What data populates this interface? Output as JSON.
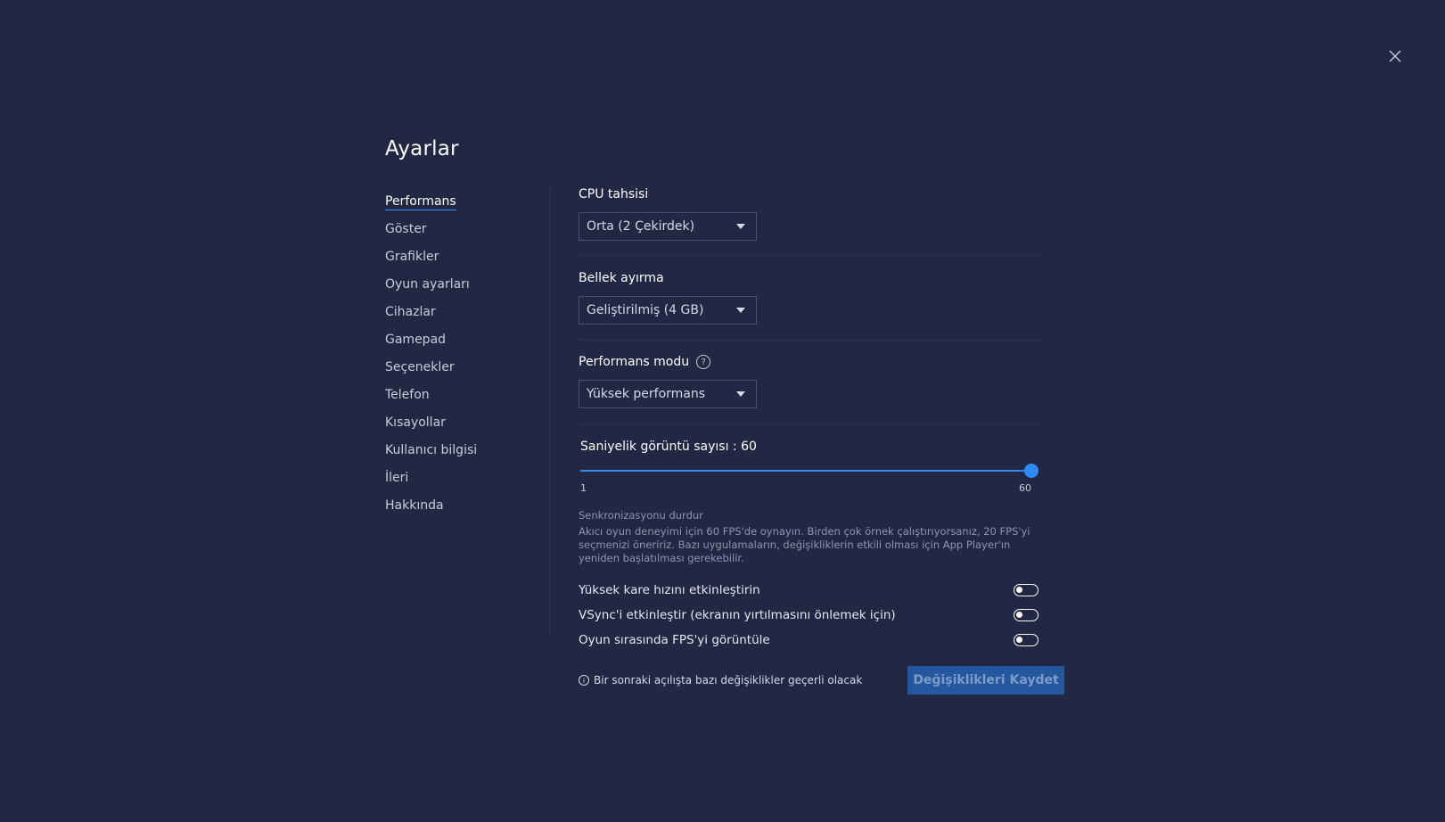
{
  "window": {
    "title": "Ayarlar"
  },
  "sidebar": {
    "items": [
      {
        "label": "Performans",
        "active": true
      },
      {
        "label": "Göster"
      },
      {
        "label": "Grafikler"
      },
      {
        "label": "Oyun ayarları"
      },
      {
        "label": "Cihazlar"
      },
      {
        "label": "Gamepad"
      },
      {
        "label": "Seçenekler"
      },
      {
        "label": "Telefon"
      },
      {
        "label": "Kısayollar"
      },
      {
        "label": "Kullanıcı bilgisi"
      },
      {
        "label": "İleri"
      },
      {
        "label": "Hakkında"
      }
    ]
  },
  "performance": {
    "cpu": {
      "label": "CPU tahsisi",
      "value": "Orta (2 Çekirdek)"
    },
    "memory": {
      "label": "Bellek ayırma",
      "value": "Geliştirilmiş (4 GB)"
    },
    "mode": {
      "label": "Performans modu",
      "help_icon": "?",
      "value": "Yüksek performans"
    },
    "fps": {
      "label": "Saniyelik görüntü sayısı : 60",
      "value": 60,
      "min": 1,
      "max": 60,
      "min_label": "1",
      "max_label": "60",
      "sync_label": "Senkronizasyonu durdur",
      "description": "Akıcı oyun deneyimi için 60 FPS'de oynayın. Birden çok örnek çalıştırıyorsanız, 20 FPS'yi seçmenizi öneririz. Bazı uygulamaların, değişikliklerin etkili olması için App Player'ın yeniden başlatılması gerekebilir."
    },
    "toggles": [
      {
        "label": "Yüksek kare hızını etkinleştirin",
        "on": false
      },
      {
        "label": "VSync'i etkinleştir (ekranın yırtılmasını önlemek için)",
        "on": false
      },
      {
        "label": "Oyun sırasında FPS'yi görüntüle",
        "on": false
      }
    ]
  },
  "footer": {
    "info_icon": "i",
    "notice": "Bir sonraki açılışta bazı değişiklikler geçerli olacak",
    "save_label": "Değişiklikleri Kaydet"
  },
  "colors": {
    "background": "#222744",
    "accent": "#2f8cf5",
    "save_button": "#23579e"
  }
}
